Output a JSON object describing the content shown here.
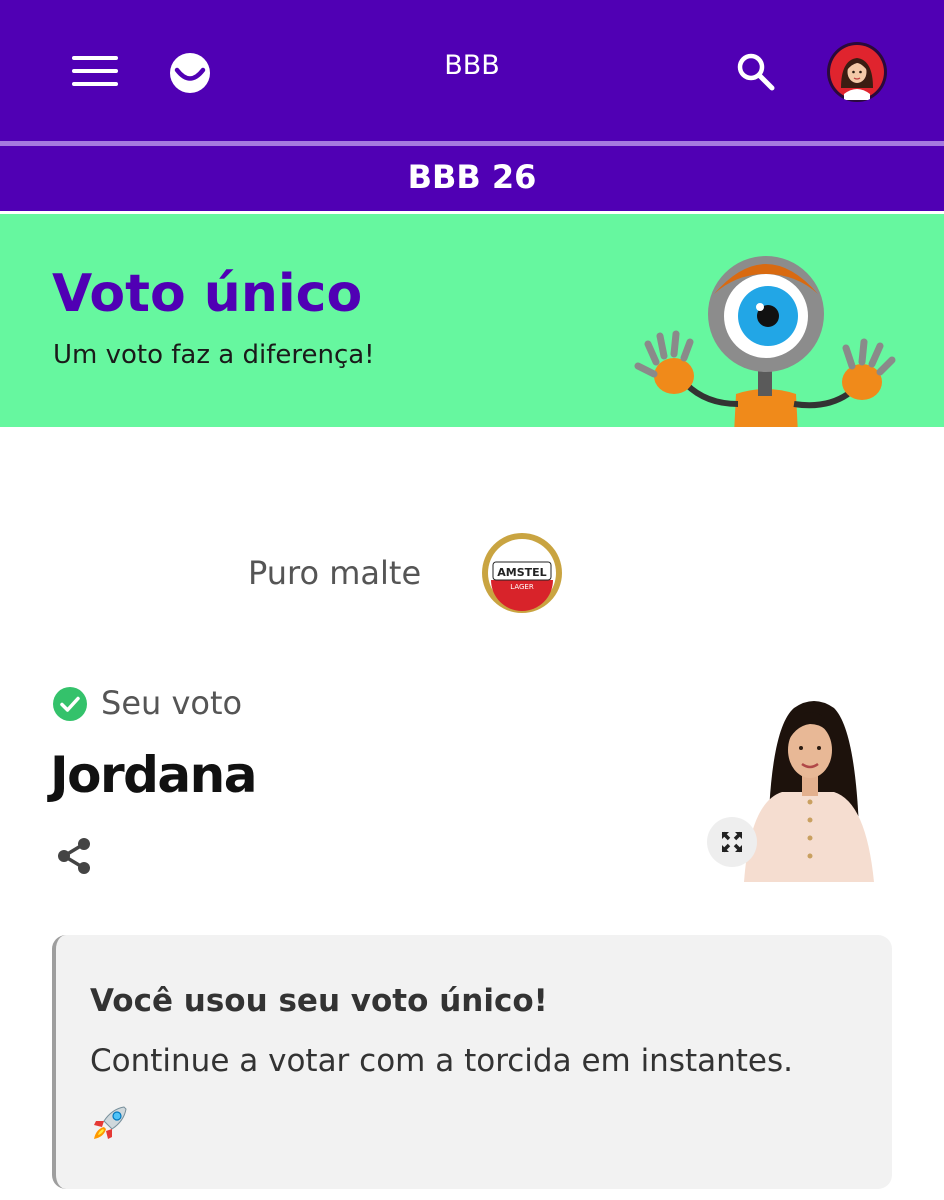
{
  "header": {
    "title": "BBB",
    "icons": {
      "menu": "hamburger-menu-icon",
      "logo": "smile-logo-icon",
      "search": "search-icon",
      "avatar": "user-avatar"
    }
  },
  "section": {
    "title": "BBB 26"
  },
  "banner": {
    "title": "Voto único",
    "subtitle": "Um voto faz a diferença!",
    "illustration": "big-eye-mascot",
    "background_color": "#66f79f",
    "title_color": "#5000b4"
  },
  "sponsor": {
    "text": "Puro malte",
    "logo_text": "AMSTEL",
    "logo_subtext": "LAGER"
  },
  "vote": {
    "label": "Seu voto",
    "candidate": "Jordana",
    "icons": {
      "status": "check-circle-icon",
      "share": "share-icon",
      "expand": "expand-icon"
    }
  },
  "message": {
    "title": "Você usou seu voto único!",
    "body": "Continue a votar com a torcida em instantes.",
    "emoji": "rocket-emoji"
  },
  "colors": {
    "brand_purple": "#5000b4",
    "divider": "#a679e0",
    "banner_green": "#66f79f",
    "check_green": "#34c26b",
    "card_bg": "#f2f2f2"
  }
}
